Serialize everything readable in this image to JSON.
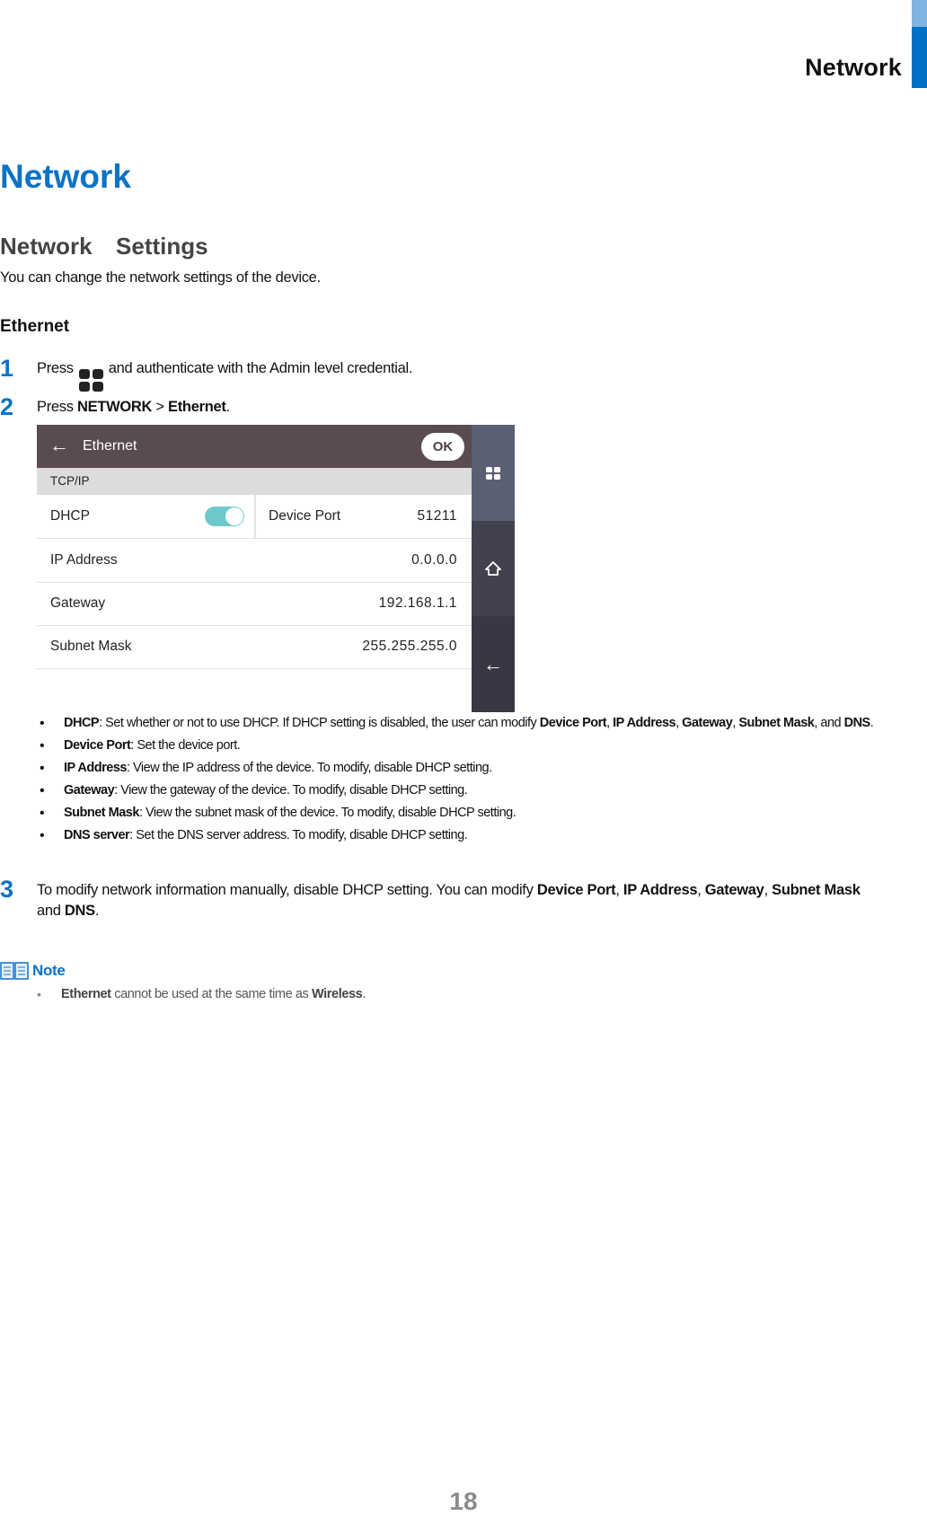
{
  "running_head": "Network",
  "title": "Network",
  "section": {
    "heading": "Network  Settings",
    "intro": "You can change the network settings of the device.",
    "subheading": "Ethernet"
  },
  "steps": [
    {
      "num": "1",
      "before": "Press",
      "icon": "menu-grid-icon",
      "after": "and authenticate with the Admin level credential."
    },
    {
      "num": "2",
      "prefix": "Press ",
      "b1": "NETWORK",
      "sep": " > ",
      "b2": "Ethernet",
      "suffix": "."
    },
    {
      "num": "3",
      "line1_text": "To modify network information manually, disable DHCP setting. You can modify ",
      "line1_b1": "Device Port",
      "line1_c1": ", ",
      "line1_b2": "IP Address",
      "line1_c2": ", ",
      "line1_b3": "Gateway",
      "line1_c3": ", ",
      "line1_b4": "Subnet Mask",
      "line2_text": "and ",
      "line2_b": "DNS",
      "line2_end": "."
    }
  ],
  "device": {
    "header_title": "Ethernet",
    "ok_label": "OK",
    "section_label": "TCP/IP",
    "dhcp_label": "DHCP",
    "dhcp_enabled": true,
    "device_port_label": "Device Port",
    "device_port_value": "51211",
    "rows": [
      {
        "label": "IP Address",
        "value": "0.0.0.0"
      },
      {
        "label": "Gateway",
        "value": "192.168.1.1"
      },
      {
        "label": "Subnet Mask",
        "value": "255.255.255.0"
      }
    ],
    "side_buttons": [
      "menu-grid-icon",
      "home-icon",
      "back-arrow-icon"
    ],
    "colors": {
      "header": "#5a4b50",
      "toggle": "#6fc8cc",
      "side_top": "#5a5f74",
      "side_mid": "#42424f",
      "side_bottom": "#3a3745"
    }
  },
  "bullets": [
    {
      "term": "DHCP",
      "text": ": Set whether or not to use DHCP. If DHCP setting is disabled, the user can modify ",
      "b1": "Device Port",
      "c1": ", ",
      "b2": "IP Address",
      "c2": ", ",
      "b3": "Gateway",
      "c3": ", ",
      "b4": "Subnet Mask",
      "c4": ", and ",
      "b5": "DNS",
      "c5": "."
    },
    {
      "term": "Device Port",
      "text": ": Set the device port."
    },
    {
      "term": "IP Address",
      "text": ": View the IP address of the device. To modify, disable DHCP setting."
    },
    {
      "term": "Gateway",
      "text": ": View the gateway of the device. To modify, disable DHCP setting."
    },
    {
      "term": "Subnet Mask",
      "text": ": View the subnet mask of the device. To modify, disable DHCP setting."
    },
    {
      "term": "DNS server",
      "text": ": Set the DNS server address. To modify, disable DHCP setting."
    }
  ],
  "note": {
    "label": "Note",
    "item_b1": "Ethernet",
    "item_text": " cannot be used at the same time as ",
    "item_b2": "Wireless",
    "item_end": "."
  },
  "page_number": "18",
  "colors": {
    "accent": "#0b73c6",
    "tab_light": "#7fb4e2"
  }
}
